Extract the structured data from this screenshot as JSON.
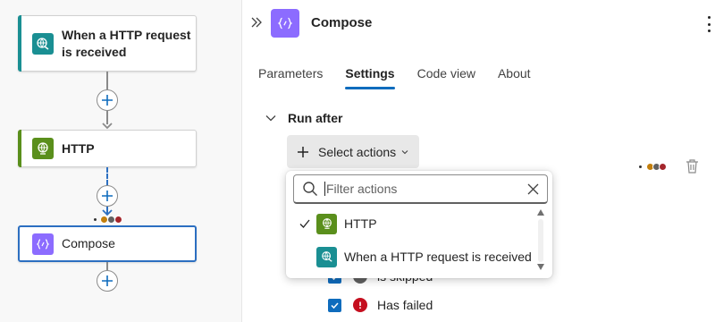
{
  "canvas": {
    "nodes": [
      {
        "label": "When a HTTP request is received",
        "icon": "http-request-trigger-icon",
        "accent": "#1a8f93"
      },
      {
        "label": "HTTP",
        "icon": "http-globe-icon",
        "accent": "#5a8f1c"
      },
      {
        "label": "Compose",
        "icon": "compose-icon",
        "accent": "#8c6cff"
      }
    ],
    "status_colors": [
      "#c37f0c",
      "#616161",
      "#a4262c"
    ]
  },
  "panel": {
    "title": "Compose",
    "tabs": [
      {
        "label": "Parameters",
        "active": false
      },
      {
        "label": "Settings",
        "active": true
      },
      {
        "label": "Code view",
        "active": false
      },
      {
        "label": "About",
        "active": false
      }
    ],
    "run_after": {
      "heading": "Run after",
      "select_button": "Select actions",
      "statuses": [
        {
          "label": "is skipped",
          "checked": true,
          "icon": "skipped-icon",
          "color": "#616161"
        },
        {
          "label": "Has failed",
          "checked": true,
          "icon": "failed-icon",
          "color": "#c50f1f"
        }
      ]
    }
  },
  "dropdown": {
    "placeholder": "Filter actions",
    "options": [
      {
        "label": "HTTP",
        "selected": true,
        "icon": "http-globe-icon",
        "color": "#5a8f1c"
      },
      {
        "label": "When a HTTP request is received",
        "selected": false,
        "icon": "http-request-trigger-icon",
        "color": "#1a8f93"
      }
    ]
  },
  "colors": {
    "accent": "#0f6cbd",
    "selected_border": "#2c6fc1"
  }
}
